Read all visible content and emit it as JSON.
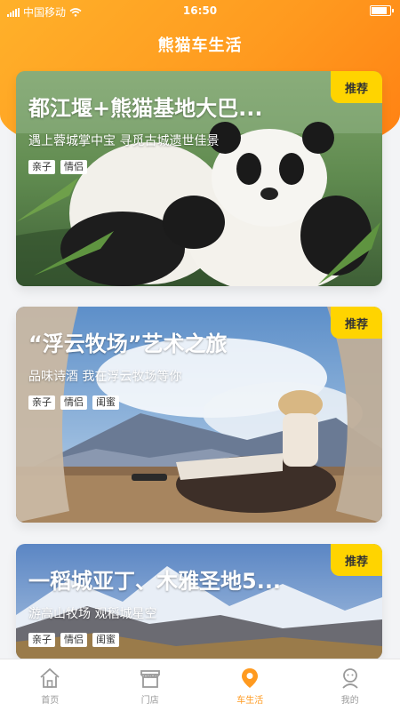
{
  "status": {
    "carrier": "中国移动",
    "time": "16:50"
  },
  "header": {
    "title": "熊猫车生活"
  },
  "cards": [
    {
      "badge": "推荐",
      "title": "都江堰+熊猫基地大巴...",
      "subtitle": "遇上蓉城掌中宝 寻觅古城遗世佳景",
      "tags": [
        "亲子",
        "情侣"
      ]
    },
    {
      "badge": "推荐",
      "title": "“浮云牧场”艺术之旅",
      "subtitle": "品味诗酒  我在浮云牧场等你",
      "tags": [
        "亲子",
        "情侣",
        "闺蜜"
      ]
    },
    {
      "badge": "推荐",
      "title": "一稻城亚丁、木雅圣地5...",
      "subtitle": "游高山牧场 观稻城星空",
      "tags": [
        "亲子",
        "情侣",
        "闺蜜"
      ]
    }
  ],
  "nav": {
    "items": [
      {
        "label": "首页",
        "icon": "home-icon"
      },
      {
        "label": "门店",
        "icon": "store-icon"
      },
      {
        "label": "车生活",
        "icon": "location-pin-icon"
      },
      {
        "label": "我的",
        "icon": "profile-icon"
      }
    ],
    "active_index": 2
  },
  "colors": {
    "accent": "#ff9a1f",
    "badge": "#ffd400",
    "nav_inactive": "#9a9a9a"
  }
}
